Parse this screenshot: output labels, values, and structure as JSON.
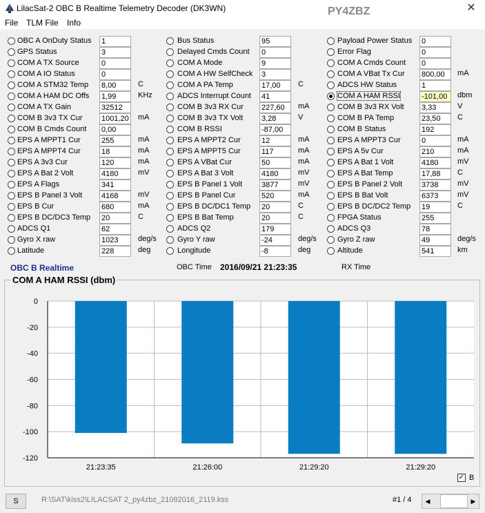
{
  "window": {
    "title": "LilacSat-2 OBC B Realtime Telemetry Decoder (DK3WN)",
    "callsign": "PY4ZBZ",
    "close_glyph": "✕"
  },
  "menu": [
    "File",
    "TLM File",
    "Info"
  ],
  "telemetry": {
    "columns": [
      [
        {
          "label": "OBC A OnDuty Status",
          "value": "1",
          "unit": ""
        },
        {
          "label": "GPS Status",
          "value": "3",
          "unit": ""
        },
        {
          "label": "COM A TX Source",
          "value": "0",
          "unit": ""
        },
        {
          "label": "COM A IO Status",
          "value": "0",
          "unit": ""
        },
        {
          "label": "COM A STM32 Temp",
          "value": "8,00",
          "unit": "C"
        },
        {
          "label": "COM A HAM DC Offs",
          "value": "1,99",
          "unit": "KHz"
        },
        {
          "label": "COM A TX Gain",
          "value": "32512",
          "unit": ""
        },
        {
          "label": "COM B 3v3 TX Cur",
          "value": "1001,20",
          "unit": "mA"
        },
        {
          "label": "COM B Cmds Count",
          "value": "0,00",
          "unit": ""
        },
        {
          "label": "EPS A MPPT1 Cur",
          "value": "255",
          "unit": "mA"
        },
        {
          "label": "EPS A MPPT4 Cur",
          "value": "18",
          "unit": "mA"
        },
        {
          "label": "EPS A 3v3 Cur",
          "value": "120",
          "unit": "mA"
        },
        {
          "label": "EPS A Bat 2 Volt",
          "value": "4180",
          "unit": "mV"
        },
        {
          "label": "EPS A Flags",
          "value": "341",
          "unit": ""
        },
        {
          "label": "EPS B Panel 3 Volt",
          "value": "4168",
          "unit": "mV"
        },
        {
          "label": "EPS B Cur",
          "value": "680",
          "unit": "mA"
        },
        {
          "label": "EPS B DC/DC3 Temp",
          "value": "20",
          "unit": "C"
        },
        {
          "label": "ADCS Q1",
          "value": "62",
          "unit": ""
        },
        {
          "label": "Gyro X raw",
          "value": "1023",
          "unit": "deg/s"
        },
        {
          "label": "Latitude",
          "value": "228",
          "unit": "deg"
        }
      ],
      [
        {
          "label": "Bus Status",
          "value": "95",
          "unit": ""
        },
        {
          "label": "Delayed Cmds Count",
          "value": "0",
          "unit": ""
        },
        {
          "label": "COM A Mode",
          "value": "9",
          "unit": ""
        },
        {
          "label": "COM A HW SelfCheck",
          "value": "3",
          "unit": ""
        },
        {
          "label": "COM A PA Temp",
          "value": "17,00",
          "unit": "C"
        },
        {
          "label": "ADCS Interrupt Count",
          "value": "41",
          "unit": ""
        },
        {
          "label": "COM B 3v3 RX Cur",
          "value": "227,60",
          "unit": "mA"
        },
        {
          "label": "COM B 3v3 TX Volt",
          "value": "3,28",
          "unit": "V"
        },
        {
          "label": "COM B RSSI",
          "value": "-87,00",
          "unit": ""
        },
        {
          "label": "EPS A MPPT2 Cur",
          "value": "12",
          "unit": "mA"
        },
        {
          "label": "EPS A MPPT5 Cur",
          "value": "117",
          "unit": "mA"
        },
        {
          "label": "EPS A VBat Cur",
          "value": "50",
          "unit": "mA"
        },
        {
          "label": "EPS A Bat 3 Volt",
          "value": "4180",
          "unit": "mV"
        },
        {
          "label": "EPS B Panel 1 Volt",
          "value": "3877",
          "unit": "mV"
        },
        {
          "label": "EPS B Panel Cur",
          "value": "520",
          "unit": "mA"
        },
        {
          "label": "EPS B DC/DC1 Temp",
          "value": "20",
          "unit": "C"
        },
        {
          "label": "EPS B Bat Temp",
          "value": "20",
          "unit": "C"
        },
        {
          "label": "ADCS Q2",
          "value": "179",
          "unit": ""
        },
        {
          "label": "Gyro Y raw",
          "value": "-24",
          "unit": "deg/s"
        },
        {
          "label": "Longitude",
          "value": "-8",
          "unit": "deg"
        }
      ],
      [
        {
          "label": "Payload Power Status",
          "value": "0",
          "unit": ""
        },
        {
          "label": "Error Flag",
          "value": "0",
          "unit": ""
        },
        {
          "label": "COM A Cmds Count",
          "value": "0",
          "unit": ""
        },
        {
          "label": "COM A VBat Tx Cur",
          "value": "800,00",
          "unit": "mA"
        },
        {
          "label": "ADCS HW Status",
          "value": "1",
          "unit": ""
        },
        {
          "label": "COM A HAM RSSI",
          "value": "-101,00",
          "unit": "dbm"
        },
        {
          "label": "COM B 3v3 RX Volt",
          "value": "3,33",
          "unit": "V"
        },
        {
          "label": "COM B PA Temp",
          "value": "23,50",
          "unit": "C"
        },
        {
          "label": "COM B Status",
          "value": "192",
          "unit": ""
        },
        {
          "label": "EPS A MPPT3 Cur",
          "value": "0",
          "unit": "mA"
        },
        {
          "label": "EPS A 5v Cur",
          "value": "210",
          "unit": "mA"
        },
        {
          "label": "EPS A Bat 1 Volt",
          "value": "4180",
          "unit": "mV"
        },
        {
          "label": "EPS A Bat Temp",
          "value": "17,88",
          "unit": "C"
        },
        {
          "label": "EPS B Panel 2 Volt",
          "value": "3738",
          "unit": "mV"
        },
        {
          "label": "EPS B Bat Volt",
          "value": "6373",
          "unit": "mV"
        },
        {
          "label": "EPS B DC/DC2 Temp",
          "value": "19",
          "unit": "C"
        },
        {
          "label": "FPGA Status",
          "value": "255",
          "unit": ""
        },
        {
          "label": "ADCS Q3",
          "value": "78",
          "unit": ""
        },
        {
          "label": "Gyro Z raw",
          "value": "49",
          "unit": "deg/s"
        },
        {
          "label": "Altitude",
          "value": "541",
          "unit": "km"
        }
      ]
    ]
  },
  "info": {
    "mode": "OBC B Realtime",
    "obc_time_label": "OBC Time",
    "obc_time": "2016/09/21  21:23:35",
    "rx_time_label": "RX Time"
  },
  "chart_data": {
    "type": "bar",
    "title": "COM A HAM RSSI (dbm)",
    "categories": [
      "21:23:35",
      "21:26:00",
      "21:29:20",
      "21:29:20"
    ],
    "values": [
      -101,
      -109,
      -117,
      -117
    ],
    "ylim": [
      -120,
      0
    ],
    "yticks": [
      0,
      -20,
      -40,
      -60,
      -80,
      -100,
      -120
    ],
    "bar_color": "#0a7cc1",
    "grid": true
  },
  "checkbox": {
    "label": "B",
    "checked": true,
    "mark": "✓"
  },
  "status": {
    "button": "S",
    "file_path": "R:\\SAT\\kiss2\\LILACSAT 2_py4zbz_21092016_2119.kss",
    "page": "#1 / 4",
    "left_arrow": "◀",
    "right_arrow": "▶"
  }
}
